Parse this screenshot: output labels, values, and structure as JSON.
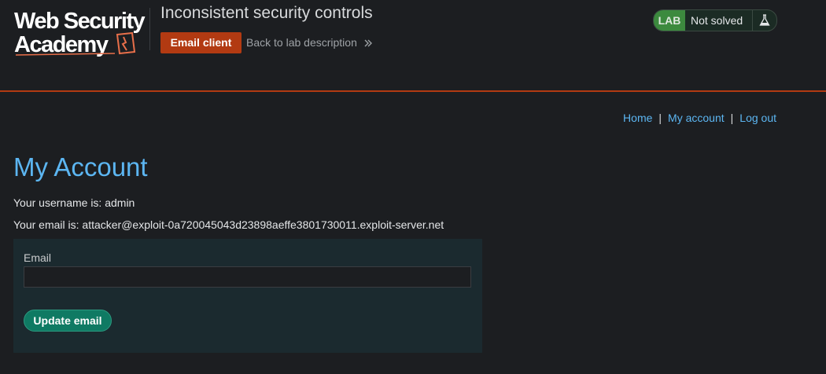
{
  "header": {
    "logo_line1": "Web Security",
    "logo_line2": "Academy",
    "lab_title": "Inconsistent security controls",
    "email_client_label": "Email client",
    "back_link_label": "Back to lab description",
    "lab_badge": "LAB",
    "lab_state": "Not solved",
    "colors": {
      "accent": "#b23a12",
      "lab_badge": "#3c8a3e"
    }
  },
  "nav": {
    "items": [
      {
        "label": "Home"
      },
      {
        "label": "My account"
      },
      {
        "label": "Log out"
      }
    ],
    "separator": "|"
  },
  "account": {
    "title": "My Account",
    "username_line": "Your username is: admin",
    "email_line": "Your email is: attacker@exploit-0a720045043d23898aeffe3801730011.exploit-server.net",
    "form": {
      "email_label": "Email",
      "email_value": "",
      "submit_label": "Update email"
    }
  },
  "icons": {
    "logo_bolt": "lightning-icon",
    "back_chevron": "double-chevron-right-icon",
    "flask": "flask-icon"
  }
}
